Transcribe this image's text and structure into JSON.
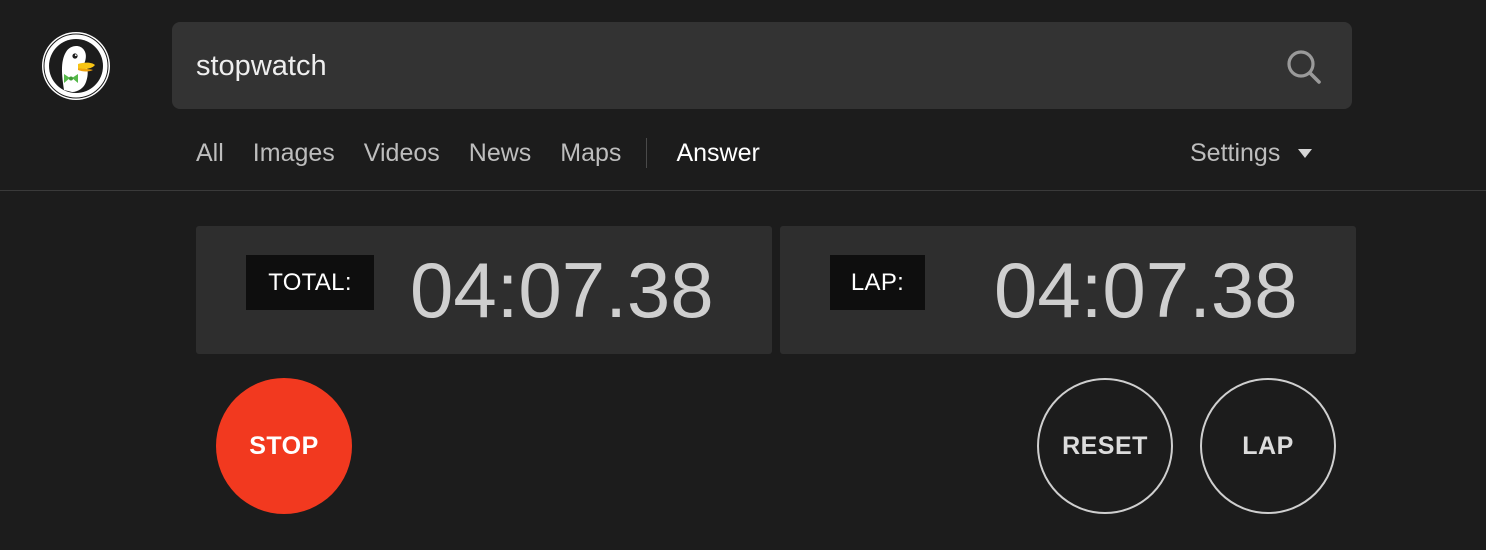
{
  "search": {
    "query": "stopwatch"
  },
  "nav": {
    "items": [
      {
        "label": "All"
      },
      {
        "label": "Images"
      },
      {
        "label": "Videos"
      },
      {
        "label": "News"
      },
      {
        "label": "Maps"
      },
      {
        "label": "Answer",
        "active": true
      }
    ],
    "settings_label": "Settings"
  },
  "stopwatch": {
    "total_label": "TOTAL:",
    "total_time": "04:07.38",
    "lap_label": "LAP:",
    "lap_time": "04:07.38",
    "stop_label": "STOP",
    "reset_label": "RESET",
    "lap_button_label": "LAP"
  },
  "icons": {
    "logo": "duckduckgo-logo-icon",
    "search": "search-icon",
    "settings_caret": "caret-down-icon"
  },
  "colors": {
    "background": "#1c1c1c",
    "search_box": "#333333",
    "panel": "#2e2e2e",
    "label_box": "#0e0e0e",
    "stop_button": "#f2391f"
  }
}
